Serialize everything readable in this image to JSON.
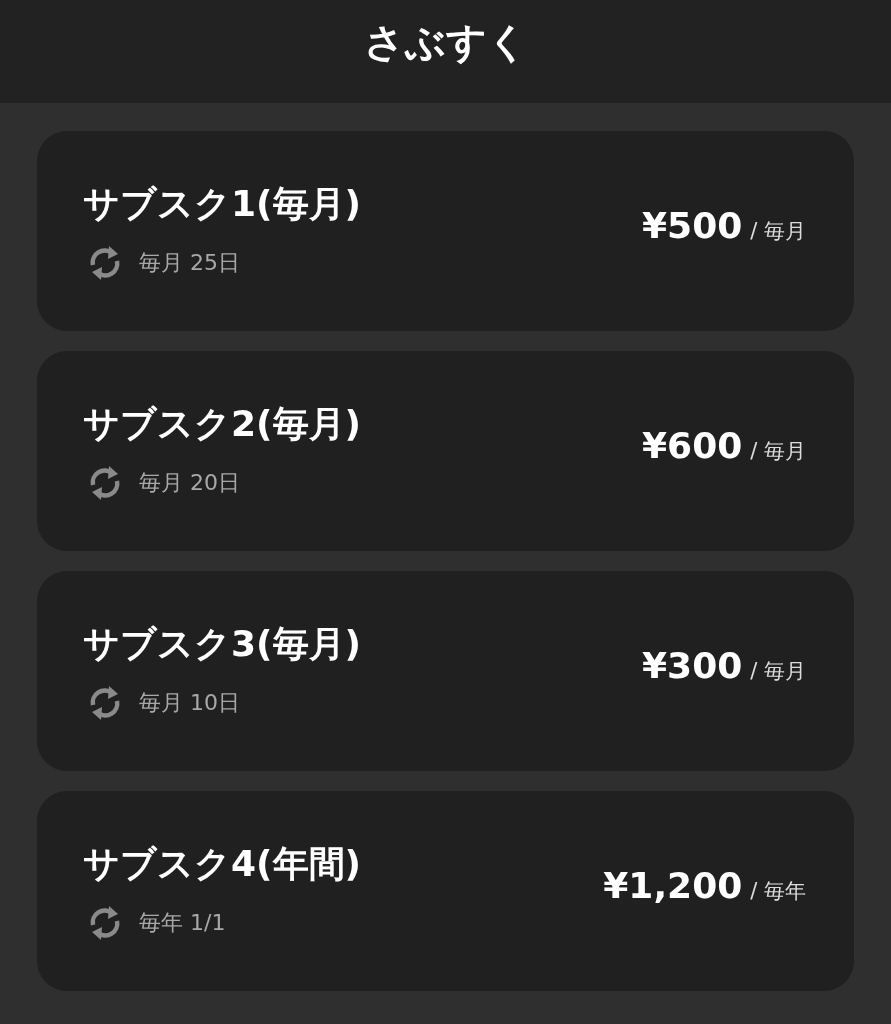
{
  "header": {
    "title": "さぶすく"
  },
  "subscriptions": [
    {
      "name": "サブスク1(毎月)",
      "schedule": "毎月 25日",
      "price": "¥500",
      "period": "/ 毎月"
    },
    {
      "name": "サブスク2(毎月)",
      "schedule": "毎月 20日",
      "price": "¥600",
      "period": "/ 毎月"
    },
    {
      "name": "サブスク3(毎月)",
      "schedule": "毎月 10日",
      "price": "¥300",
      "period": "/ 毎月"
    },
    {
      "name": "サブスク4(年間)",
      "schedule": "毎年 1/1",
      "price": "¥1,200",
      "period": "/ 毎年"
    }
  ]
}
